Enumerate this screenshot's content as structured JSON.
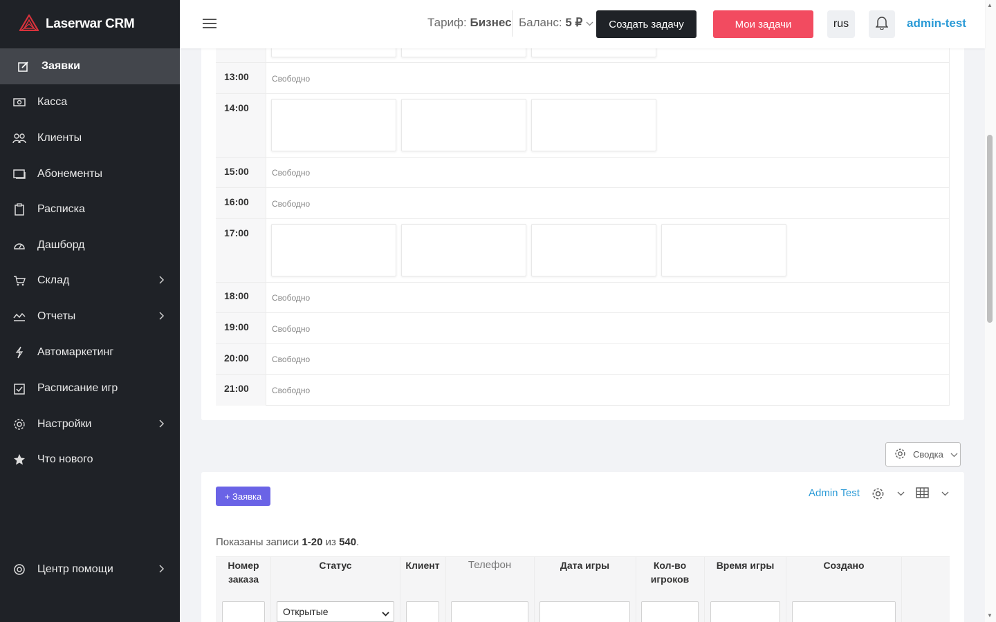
{
  "brand": {
    "name": "Laserwar CRM"
  },
  "sidebar": {
    "items": [
      {
        "label": "Заявки",
        "icon": "edit-icon"
      },
      {
        "label": "Касса",
        "icon": "cash-icon"
      },
      {
        "label": "Клиенты",
        "icon": "users-icon"
      },
      {
        "label": "Абонементы",
        "icon": "card-icon"
      },
      {
        "label": "Расписка",
        "icon": "clipboard-icon"
      },
      {
        "label": "Дашборд",
        "icon": "dashboard-icon"
      },
      {
        "label": "Склад",
        "icon": "cart-icon"
      },
      {
        "label": "Отчеты",
        "icon": "chart-icon"
      },
      {
        "label": "Автомаркетинг",
        "icon": "lightning-icon"
      },
      {
        "label": "Расписание игр",
        "icon": "calendar-check-icon"
      },
      {
        "label": "Настройки",
        "icon": "gear-icon"
      },
      {
        "label": "Что нового",
        "icon": "star-icon"
      },
      {
        "label": "Центр помощи",
        "icon": "lifebuoy-icon"
      }
    ]
  },
  "header": {
    "tariff_label": "Тариф:",
    "tariff_value": "Бизнес",
    "balance_label": "Баланс:",
    "balance_value": "5 ₽",
    "create_task": "Создать задачу",
    "my_tasks": "Мои задачи",
    "lang": "rus",
    "user": "admin-test"
  },
  "schedule": {
    "free_text": "Свободно",
    "rows": [
      {
        "time": "13:00",
        "free": true
      },
      {
        "time": "14:00",
        "free": false
      },
      {
        "time": "15:00",
        "free": true
      },
      {
        "time": "16:00",
        "free": true
      },
      {
        "time": "17:00",
        "free": false
      },
      {
        "time": "18:00",
        "free": true
      },
      {
        "time": "19:00",
        "free": true
      },
      {
        "time": "20:00",
        "free": true
      },
      {
        "time": "21:00",
        "free": true
      }
    ]
  },
  "summary": {
    "label": "Сводка"
  },
  "orders": {
    "add_button": "+ Заявка",
    "admin_filter": "Admin Test",
    "shown_prefix": "Показаны записи",
    "shown_range": "1-20",
    "shown_of": "из",
    "shown_total": "540",
    "columns": {
      "order_no": "Номер заказа",
      "status": "Статус",
      "client": "Клиент",
      "phone": "Телефон",
      "game_date": "Дата игры",
      "players": "Кол-во игроков",
      "game_time": "Время игры",
      "created": "Создано"
    },
    "status_filter_value": "Открытые"
  },
  "colors": {
    "sidebar_bg": "#1f2227",
    "accent_red": "#f24b60",
    "accent_purple": "#6a63e6",
    "link_blue": "#2a9ad6"
  }
}
